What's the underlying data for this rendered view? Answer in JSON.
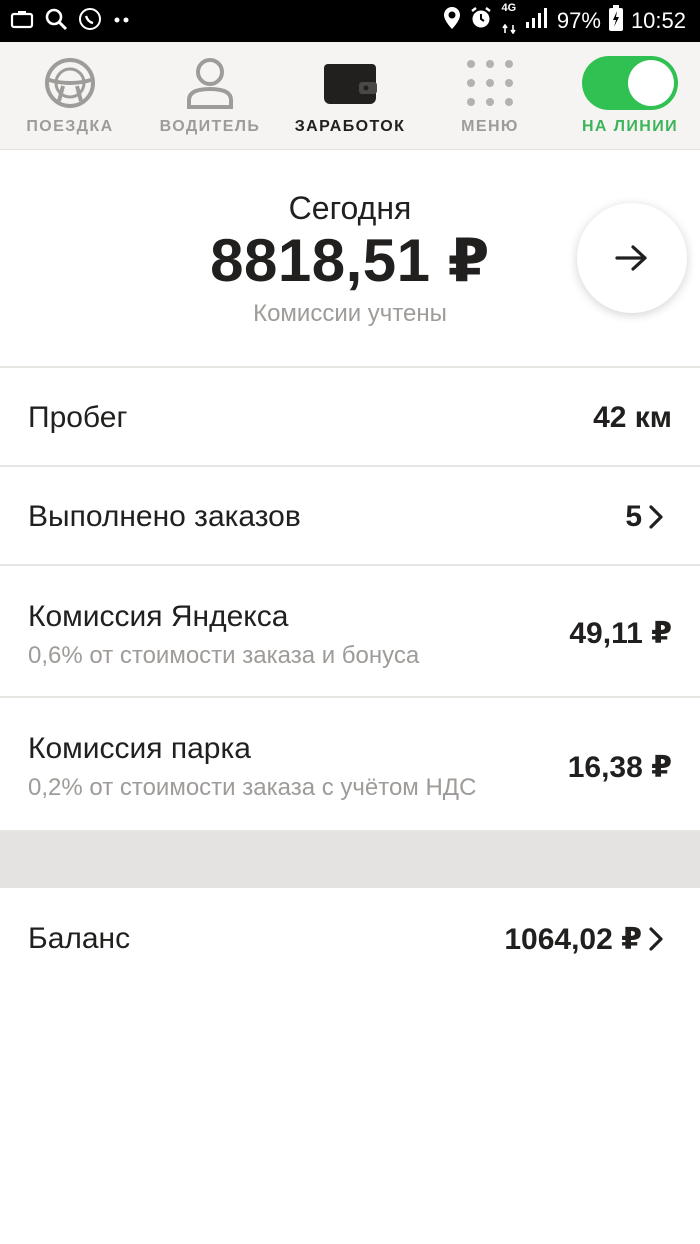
{
  "status_bar": {
    "battery": "97%",
    "time": "10:52",
    "network": "4G"
  },
  "nav": {
    "items": [
      {
        "label": "ПОЕЗДКА",
        "icon": "steering-wheel-icon"
      },
      {
        "label": "ВОДИТЕЛЬ",
        "icon": "driver-person-icon"
      },
      {
        "label": "ЗАРАБОТОК",
        "icon": "wallet-icon"
      },
      {
        "label": "МЕНЮ",
        "icon": "grid-menu-icon"
      },
      {
        "label": "НА ЛИНИИ",
        "icon": "online-toggle"
      }
    ],
    "active_index": 2,
    "online_color": "#30c152"
  },
  "summary": {
    "title": "Сегодня",
    "amount": "8818,51 ₽",
    "note": "Комиссии учтены"
  },
  "rows": {
    "mileage": {
      "label": "Пробег",
      "value": "42 км"
    },
    "orders": {
      "label": "Выполнено заказов",
      "value": "5"
    },
    "yandex_fee": {
      "label": "Комиссия Яндекса",
      "sub": "0,6% от стоимости заказа и бонуса",
      "value": "49,11 ₽"
    },
    "park_fee": {
      "label": "Комиссия парка",
      "sub": "0,2% от стоимости заказа с учётом НДС",
      "value": "16,38 ₽"
    },
    "balance": {
      "label": "Баланс",
      "value": "1064,02 ₽"
    }
  }
}
